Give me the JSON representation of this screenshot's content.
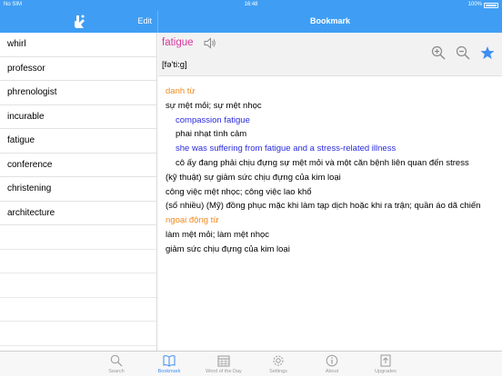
{
  "status": {
    "carrier": "No SIM",
    "time": "16:48",
    "battery": "100%"
  },
  "nav": {
    "edit_label": "Edit",
    "title": "Bookmark"
  },
  "words": [
    "whirl",
    "professor",
    "phrenologist",
    "incurable",
    "fatigue",
    "conference",
    "christening",
    "architecture"
  ],
  "entry": {
    "headword": "fatigue",
    "phonetic": "[fə'ti:g]",
    "lines": [
      {
        "type": "pos",
        "text": "danh từ"
      },
      {
        "type": "sense",
        "text": "sự mệt mỏi; sự mệt nhọc"
      },
      {
        "type": "ex-en",
        "text": "compassion fatigue"
      },
      {
        "type": "ex-vi",
        "text": "phai nhạt tình cảm"
      },
      {
        "type": "ex-en",
        "text": "she was suffering from fatigue and a stress-related illness"
      },
      {
        "type": "ex-vi",
        "text": "cô ấy đang phải chịu đựng sự mệt mỏi và một căn bệnh liên quan đến stress"
      },
      {
        "type": "sense",
        "text": "(kỹ thuật) sự giảm sức chịu đựng của kim loại"
      },
      {
        "type": "sense",
        "text": "công việc mệt nhọc; công việc lao khổ"
      },
      {
        "type": "sense",
        "text": "(số nhiều) (Mỹ) đồng phục mặc khi làm tạp dịch hoặc khi ra trận; quần áo dã chiến"
      },
      {
        "type": "pos",
        "text": "ngoại động từ"
      },
      {
        "type": "sense",
        "text": "làm mệt mỏi; làm mệt nhọc"
      },
      {
        "type": "sense",
        "text": "giảm sức chịu đựng của kim loại"
      }
    ]
  },
  "tabs": [
    {
      "label": "Search",
      "icon": "search-icon"
    },
    {
      "label": "Bookmark",
      "icon": "book-icon",
      "active": true
    },
    {
      "label": "Word of the Day",
      "icon": "calendar-icon"
    },
    {
      "label": "Settings",
      "icon": "gear-icon"
    },
    {
      "label": "About",
      "icon": "info-icon"
    },
    {
      "label": "Upgrades",
      "icon": "upgrade-icon"
    }
  ],
  "colors": {
    "accent": "#3f9ef4",
    "headword": "#d63a9b",
    "pos": "#f08a1e",
    "example": "#2b2bdd",
    "star": "#3f8ef0"
  }
}
